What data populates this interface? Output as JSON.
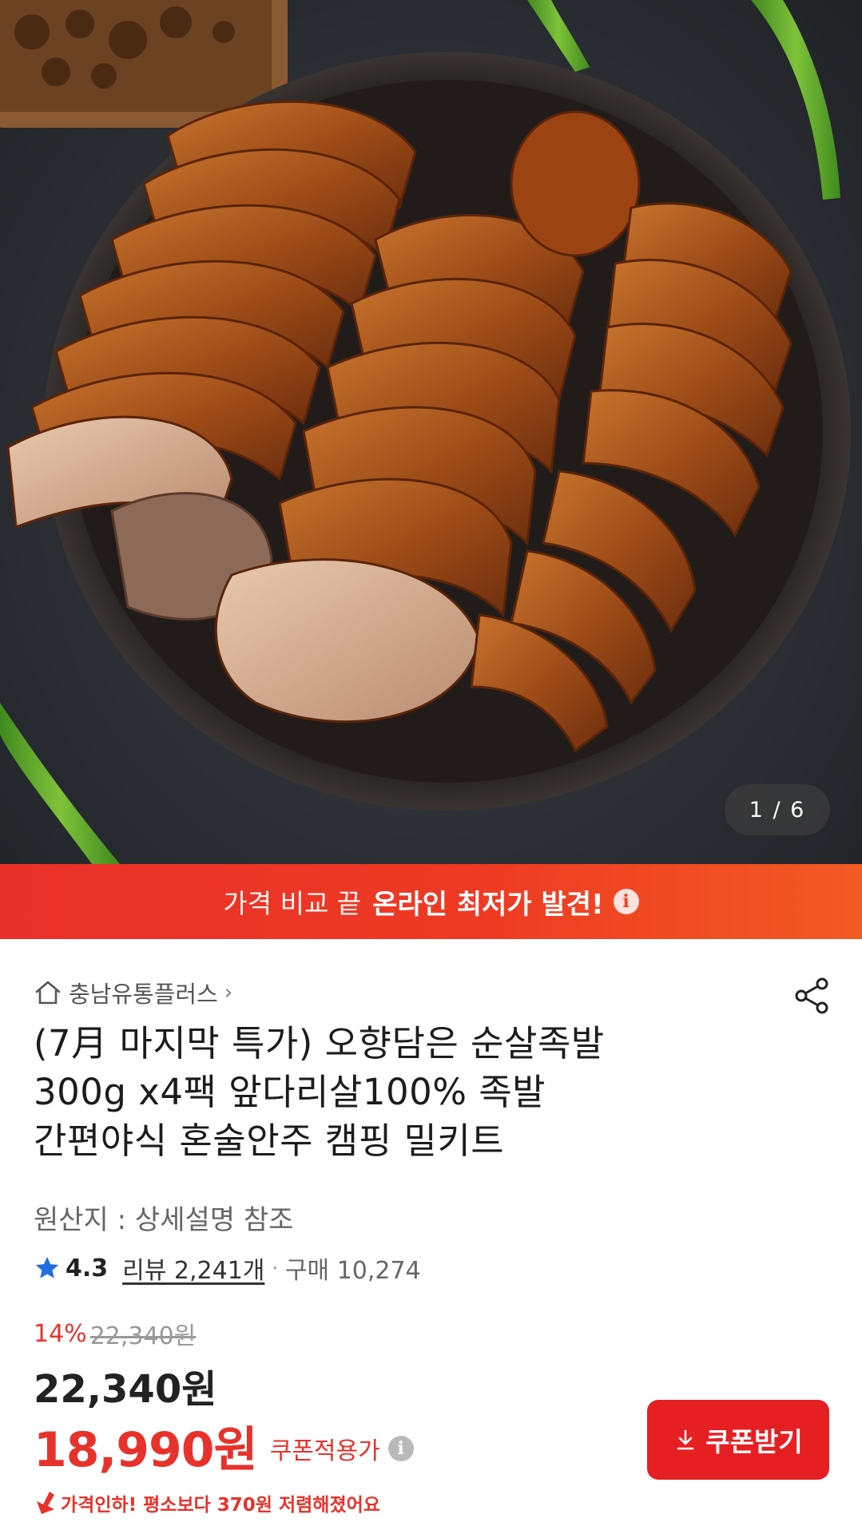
{
  "gallery": {
    "counter": "1 / 6",
    "image_alt": "pork-trotter-bowl-photo"
  },
  "promo": {
    "plain": "가격 비교 끝",
    "strong": "온라인 최저가 발견!",
    "icon": "info-icon"
  },
  "store": {
    "name": "충남유통플러스",
    "chevron": "›"
  },
  "product": {
    "title_lines": [
      "(7月 마지막 특가) 오향담은 순살족발",
      "300g x4팩 앞다리살100% 족발",
      "간편야식 혼술안주 캠핑 밀키트"
    ],
    "origin": "원산지 : 상세설명 참조",
    "rating": "4.3",
    "reviews": "리뷰 2,241개",
    "separator": "·",
    "purchases": "구매 10,274"
  },
  "price": {
    "discount_pct": "14%",
    "original": "22,340원",
    "sale": "22,340원",
    "coupon_price": "18,990원",
    "coupon_label": "쿠폰적용가",
    "coupon_button": "쿠폰받기",
    "drop_notice": "가격인하! 평소보다 370원 저렴해졌어요"
  },
  "colors": {
    "accent_red": "#e7322b",
    "button_red": "#e61f23",
    "rating_star": "#1f6fe0"
  }
}
